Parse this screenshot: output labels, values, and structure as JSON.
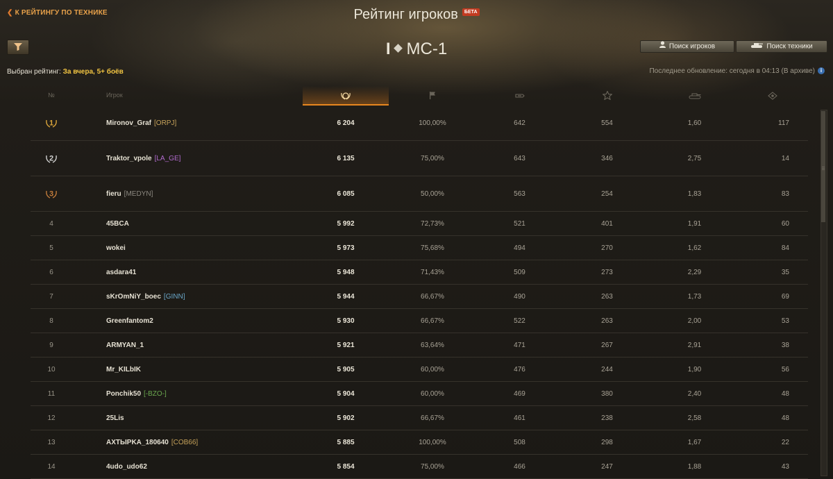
{
  "header": {
    "back_label": "К РЕЙТИНГУ ПО ТЕХНИКЕ",
    "title": "Рейтинг игроков",
    "beta_badge": "БЕТА"
  },
  "vehicle": {
    "tier": "I",
    "name": "МС-1"
  },
  "filter": {
    "label": "Выбран рейтинг:",
    "value": "За вчера, 5+ боёв"
  },
  "buttons": {
    "search_players": "Поиск игроков",
    "search_vehicles": "Поиск техники"
  },
  "update": {
    "text": "Последнее обновление: сегодня в 04:13 (В архиве)"
  },
  "columns": {
    "rank": "№",
    "player": "Игрок",
    "icons": [
      "laurel-wreath-icon",
      "flag-icon",
      "damage-icon",
      "star-icon",
      "tank-icon",
      "spotting-icon"
    ]
  },
  "colors": {
    "accent": "#e7871f",
    "score": "#ece7d9",
    "clan_orpj": "#c7a35a",
    "clan_la_ge": "#b26bd0",
    "clan_medyn": "#8c8880",
    "clan_ginn": "#6aa6c8",
    "clan_bzo": "#6aa84f",
    "clan_cob66": "#c7a35a"
  },
  "rows": [
    {
      "rank": "1",
      "name": "Mironov_Graf",
      "clan": "[ORPJ]",
      "clan_color": "#c7a35a",
      "score": "6 204",
      "winrate": "100,00%",
      "damage": "642",
      "xp": "554",
      "kills": "1,60",
      "spot": "117",
      "medal": "gold"
    },
    {
      "rank": "2",
      "name": "Traktor_vpole",
      "clan": "[LA_GE]",
      "clan_color": "#b26bd0",
      "score": "6 135",
      "winrate": "75,00%",
      "damage": "643",
      "xp": "346",
      "kills": "2,75",
      "spot": "14",
      "medal": "silver"
    },
    {
      "rank": "3",
      "name": "fieru",
      "clan": "[MEDYN]",
      "clan_color": "#8c8880",
      "score": "6 085",
      "winrate": "50,00%",
      "damage": "563",
      "xp": "254",
      "kills": "1,83",
      "spot": "83",
      "medal": "bronze"
    },
    {
      "rank": "4",
      "name": "45BCA",
      "clan": "",
      "clan_color": "",
      "score": "5 992",
      "winrate": "72,73%",
      "damage": "521",
      "xp": "401",
      "kills": "1,91",
      "spot": "60"
    },
    {
      "rank": "5",
      "name": "wokei",
      "clan": "",
      "clan_color": "",
      "score": "5 973",
      "winrate": "75,68%",
      "damage": "494",
      "xp": "270",
      "kills": "1,62",
      "spot": "84"
    },
    {
      "rank": "6",
      "name": "asdara41",
      "clan": "",
      "clan_color": "",
      "score": "5 948",
      "winrate": "71,43%",
      "damage": "509",
      "xp": "273",
      "kills": "2,29",
      "spot": "35"
    },
    {
      "rank": "7",
      "name": "sKrOmNiY_boec",
      "clan": "[GINN]",
      "clan_color": "#6aa6c8",
      "score": "5 944",
      "winrate": "66,67%",
      "damage": "490",
      "xp": "263",
      "kills": "1,73",
      "spot": "69"
    },
    {
      "rank": "8",
      "name": "Greenfantom2",
      "clan": "",
      "clan_color": "",
      "score": "5 930",
      "winrate": "66,67%",
      "damage": "522",
      "xp": "263",
      "kills": "2,00",
      "spot": "53"
    },
    {
      "rank": "9",
      "name": "ARMYAN_1",
      "clan": "",
      "clan_color": "",
      "score": "5 921",
      "winrate": "63,64%",
      "damage": "471",
      "xp": "267",
      "kills": "2,91",
      "spot": "38"
    },
    {
      "rank": "10",
      "name": "Mr_KILbIK",
      "clan": "",
      "clan_color": "",
      "score": "5 905",
      "winrate": "60,00%",
      "damage": "476",
      "xp": "244",
      "kills": "1,90",
      "spot": "56"
    },
    {
      "rank": "11",
      "name": "Ponchik50",
      "clan": "[-BZO-]",
      "clan_color": "#6aa84f",
      "score": "5 904",
      "winrate": "60,00%",
      "damage": "469",
      "xp": "380",
      "kills": "2,40",
      "spot": "48"
    },
    {
      "rank": "12",
      "name": "25Lis",
      "clan": "",
      "clan_color": "",
      "score": "5 902",
      "winrate": "66,67%",
      "damage": "461",
      "xp": "238",
      "kills": "2,58",
      "spot": "48"
    },
    {
      "rank": "13",
      "name": "AXTЫPKA_180640",
      "clan": "[COB66]",
      "clan_color": "#c7a35a",
      "score": "5 885",
      "winrate": "100,00%",
      "damage": "508",
      "xp": "298",
      "kills": "1,67",
      "spot": "22"
    },
    {
      "rank": "14",
      "name": "4udo_udo62",
      "clan": "",
      "clan_color": "",
      "score": "5 854",
      "winrate": "75,00%",
      "damage": "466",
      "xp": "247",
      "kills": "1,88",
      "spot": "43"
    }
  ]
}
